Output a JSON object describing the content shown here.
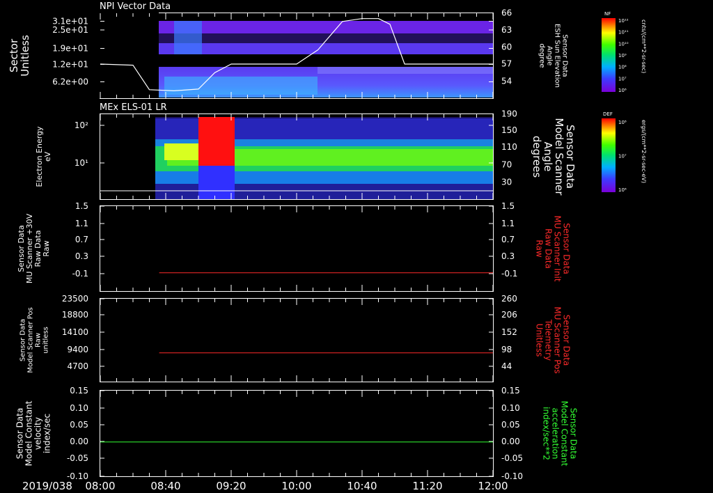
{
  "colors": {
    "background": "#000000",
    "foreground": "#ffffff",
    "scanner_red": "#ff2a2a",
    "accel_green": "#33ff33",
    "npi_curve": "#ffffff"
  },
  "time_axis": {
    "date_label": "2019/038",
    "start": "08:00",
    "end": "12:00",
    "tick_labels": [
      "08:00",
      "08:40",
      "09:20",
      "10:00",
      "10:40",
      "11:20",
      "12:00"
    ],
    "tick_minutes": [
      480,
      520,
      560,
      600,
      640,
      680,
      720
    ],
    "minor_step_minutes": 10
  },
  "chart_data": [
    {
      "type": "heatmap",
      "title": "NPI Vector Data",
      "ylabel_lines": [
        "Sector",
        "Unitless"
      ],
      "yticks": [
        "3.1e+01",
        "2.5e+01",
        "1.9e+01",
        "1.2e+01",
        "6.2e+00"
      ],
      "y2label_lines": [
        "Sensor Data",
        "ESH Sun Elevation",
        "Angle",
        "degree"
      ],
      "y2ticks": [
        "66",
        "63",
        "60",
        "57",
        "54"
      ],
      "colorbar": {
        "label": "NF",
        "units": "cnts/(cm**2-sr-sec)",
        "tick_labels": [
          "10¹²",
          "10¹¹",
          "10¹⁰",
          "10⁹",
          "10⁸",
          "10⁷",
          "10⁶"
        ]
      },
      "data_start_time": "08:34",
      "overlay_line": {
        "name": "ESH Sun Elevation Angle",
        "times": [
          "08:00",
          "08:20",
          "08:30",
          "08:45",
          "09:00",
          "09:10",
          "09:20",
          "10:00",
          "10:13",
          "10:28",
          "10:40",
          "10:50",
          "10:57",
          "11:06",
          "12:00"
        ],
        "degrees": [
          57.0,
          56.8,
          52.5,
          52.3,
          52.6,
          55.5,
          57.0,
          57.0,
          59.5,
          64.5,
          65.0,
          65.0,
          64.0,
          57.0,
          57.0
        ]
      }
    },
    {
      "type": "heatmap",
      "title": "MEx ELS-01 LR",
      "ylabel_lines": [
        "Electron Energy",
        "eV"
      ],
      "yticks": [
        "10²",
        "10¹"
      ],
      "y2label_lines": [
        "Sensor Data",
        "Model Scanner",
        "Angle",
        "degrees"
      ],
      "y2ticks": [
        "190",
        "150",
        "110",
        "70",
        "30"
      ],
      "colorbar": {
        "label": "DEF",
        "units": "ergs/(cm**2-sr-sec-eV)",
        "tick_labels": [
          "10⁸",
          "10⁷",
          "10⁶"
        ]
      },
      "data_start_time": "08:36",
      "overlay_line": {
        "name": "Model Scanner Angle",
        "value_degrees": 10
      }
    },
    {
      "type": "line",
      "ylabel_lines": [
        "Sensor Data",
        "MU Scanner +30V",
        "Raw Data",
        "Raw"
      ],
      "yticks": [
        "1.5",
        "1.1",
        "0.7",
        "0.3",
        "-0.1"
      ],
      "ylim": [
        -0.5,
        1.5
      ],
      "y2label_lines": [
        "Sensor Data",
        "MU Scanner Init",
        "Raw Data",
        "Raw"
      ],
      "y2ticks": [
        "1.5",
        "1.1",
        "0.7",
        "0.3",
        "-0.1"
      ],
      "series": [
        {
          "time_start": "08:36",
          "time_end": "12:00",
          "value": -0.07,
          "color": "#ff2a2a"
        }
      ]
    },
    {
      "type": "line",
      "ylabel_lines": [
        "Sensor Data",
        "Model Scanner Pos",
        "Raw",
        "unitless"
      ],
      "yticks": [
        "23500",
        "18800",
        "14100",
        "9400",
        "4700"
      ],
      "ylim": [
        0,
        23500
      ],
      "y2label_lines": [
        "Sensor Data",
        "MU Scanner Pos",
        "Telemetry",
        "Unitless"
      ],
      "y2ticks": [
        "260",
        "206",
        "152",
        "98",
        "44"
      ],
      "series": [
        {
          "time_start": "08:36",
          "time_end": "12:00",
          "value": 8150,
          "color": "#ff2a2a"
        }
      ]
    },
    {
      "type": "line",
      "ylabel_lines": [
        "Sensor Data",
        "Model Constant",
        "velocity",
        "index/sec"
      ],
      "yticks": [
        "0.15",
        "0.10",
        "0.05",
        "0.00",
        "-0.05",
        "-0.10"
      ],
      "ylim": [
        -0.1,
        0.15
      ],
      "y2label_lines": [
        "Sensor Data",
        "Model Constant",
        "acceleration",
        "index/sec**2"
      ],
      "y2ticks": [
        "0.15",
        "0.10",
        "0.05",
        "0.00",
        "-0.05",
        "-0.10"
      ],
      "series": [
        {
          "time_start": "08:00",
          "time_end": "12:00",
          "value": 0.0,
          "color": "#33ff33"
        }
      ]
    }
  ]
}
